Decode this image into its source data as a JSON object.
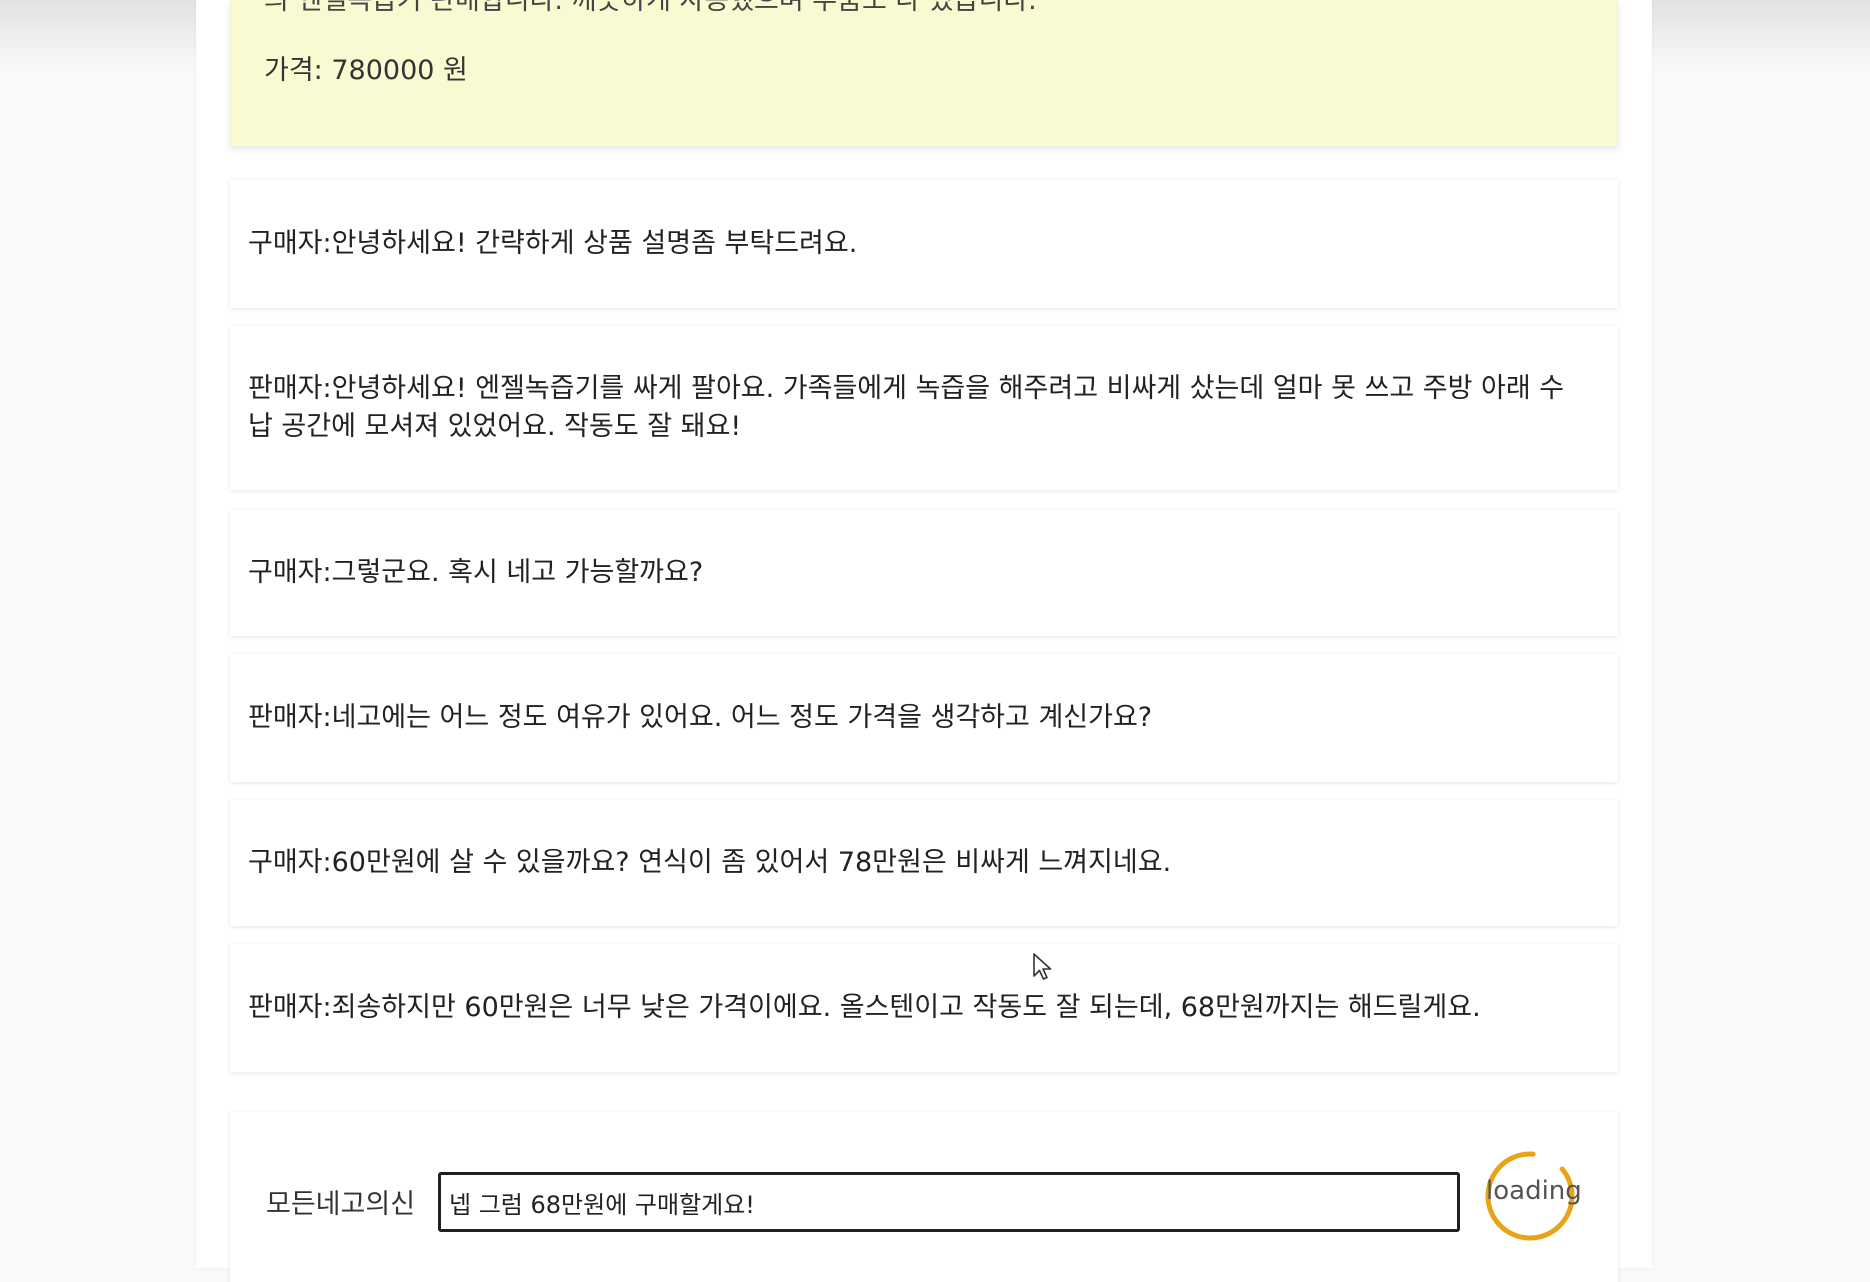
{
  "product": {
    "description_partial": "의 엔젤녹즙기 판매합니다. 깨끗하게 사용했으며 부품도 다 있습니다.",
    "price_text": "가격: 780000 원"
  },
  "messages": [
    {
      "role": "buyer",
      "text": "구매자:안녕하세요! 간략하게 상품 설명좀 부탁드려요."
    },
    {
      "role": "seller",
      "text": "판매자:안녕하세요! 엔젤녹즙기를 싸게 팔아요. 가족들에게 녹즙을 해주려고 비싸게 샀는데 얼마 못 쓰고 주방 아래 수납 공간에 모셔져 있었어요. 작동도 잘 돼요!"
    },
    {
      "role": "buyer",
      "text": "구매자:그렇군요. 혹시 네고 가능할까요?"
    },
    {
      "role": "seller",
      "text": "판매자:네고에는 어느 정도 여유가 있어요. 어느 정도 가격을 생각하고 계신가요?"
    },
    {
      "role": "buyer",
      "text": "구매자:60만원에 살 수 있을까요? 연식이 좀 있어서 78만원은 비싸게 느껴지네요."
    },
    {
      "role": "seller",
      "text": "판매자:죄송하지만 60만원은 너무 낮은 가격이에요. 올스텐이고 작동도 잘 되는데, 68만원까지는 해드릴게요."
    }
  ],
  "composer": {
    "label": "모든네고의신",
    "input_value": "넵 그럼 68만원에 구매할게요!",
    "loading_text": "loading"
  },
  "colors": {
    "product_card_bg": "#fafad2",
    "loading_accent": "#e8a317",
    "input_border": "#1f1f1f"
  },
  "icons": {
    "cursor": "mouse-pointer-icon",
    "loading": "spinner-icon"
  }
}
